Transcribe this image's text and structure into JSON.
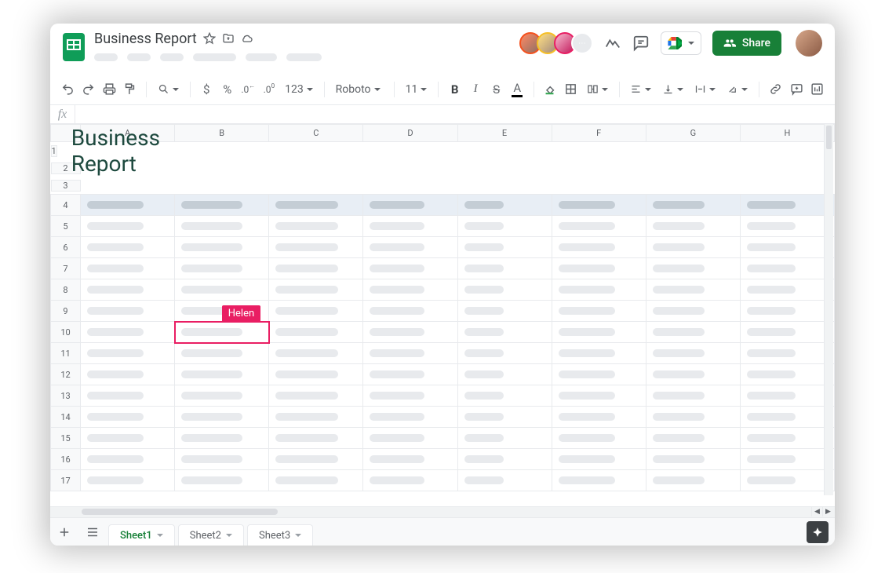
{
  "doc": {
    "title": "Business Report"
  },
  "share": {
    "label": "Share"
  },
  "collaborators": {
    "colors": [
      "#f4511e",
      "#f6bf26",
      "#e91e63"
    ],
    "cursor_name": "Helen",
    "cursor_color": "#e91e63",
    "cursor_cell": "B10"
  },
  "toolbar": {
    "font": "Roboto",
    "font_size": "11",
    "number_format": "123"
  },
  "columns": [
    "A",
    "B",
    "C",
    "D",
    "E",
    "F",
    "G",
    "H"
  ],
  "rows": [
    "1",
    "2",
    "3",
    "4",
    "5",
    "6",
    "7",
    "8",
    "9",
    "10",
    "11",
    "12",
    "13",
    "14",
    "15",
    "16",
    "17"
  ],
  "sheet_title": "Business Report",
  "tabs": [
    {
      "label": "Sheet1",
      "active": true
    },
    {
      "label": "Sheet2",
      "active": false
    },
    {
      "label": "Sheet3",
      "active": false
    }
  ]
}
